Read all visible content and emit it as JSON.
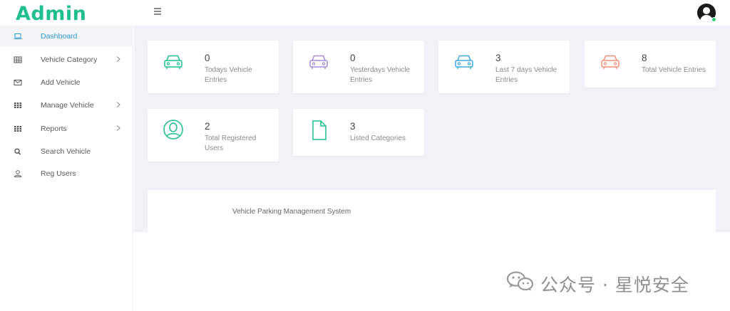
{
  "brand": {
    "title": "Admin"
  },
  "sidebar": {
    "items": [
      {
        "label": "Dashboard",
        "icon": "laptop-icon",
        "active": true
      },
      {
        "label": "Vehicle Category",
        "icon": "table-icon",
        "has_submenu": true
      },
      {
        "label": "Add Vehicle",
        "icon": "envelope-icon"
      },
      {
        "label": "Manage Vehicle",
        "icon": "grid-icon",
        "has_submenu": true
      },
      {
        "label": "Reports",
        "icon": "grid-icon",
        "has_submenu": true
      },
      {
        "label": "Search Vehicle",
        "icon": "search-icon"
      },
      {
        "label": "Reg Users",
        "icon": "user-icon"
      }
    ]
  },
  "cards": [
    {
      "value": "0",
      "label": "Todays Vehicle Entries",
      "icon": "car-icon",
      "color": "#1fbf8f"
    },
    {
      "value": "0",
      "label": "Yesterdays Vehicle Entries",
      "icon": "car-icon",
      "color": "#a78bdb"
    },
    {
      "value": "3",
      "label": "Last 7 days Vehicle Entries",
      "icon": "car-icon",
      "color": "#3fa9e0"
    },
    {
      "value": "8",
      "label": "Total Vehicle Entries",
      "icon": "car-icon",
      "color": "#f2907a"
    },
    {
      "value": "2",
      "label": "Total Registered Users",
      "icon": "user-circle-icon",
      "color": "#1fbf8f"
    },
    {
      "value": "3",
      "label": "Listed Categories",
      "icon": "file-icon",
      "color": "#1fbf8f"
    }
  ],
  "footer": {
    "text": "Vehicle Parking Management System"
  },
  "watermark": {
    "text": "公众号 · 星悦安全",
    "icon": "wechat-icon"
  },
  "colors": {
    "brand": "#1fbf8f",
    "active_nav": "#2b9bd6",
    "background": "#f1f2f7",
    "online_status": "#2ecc71"
  }
}
